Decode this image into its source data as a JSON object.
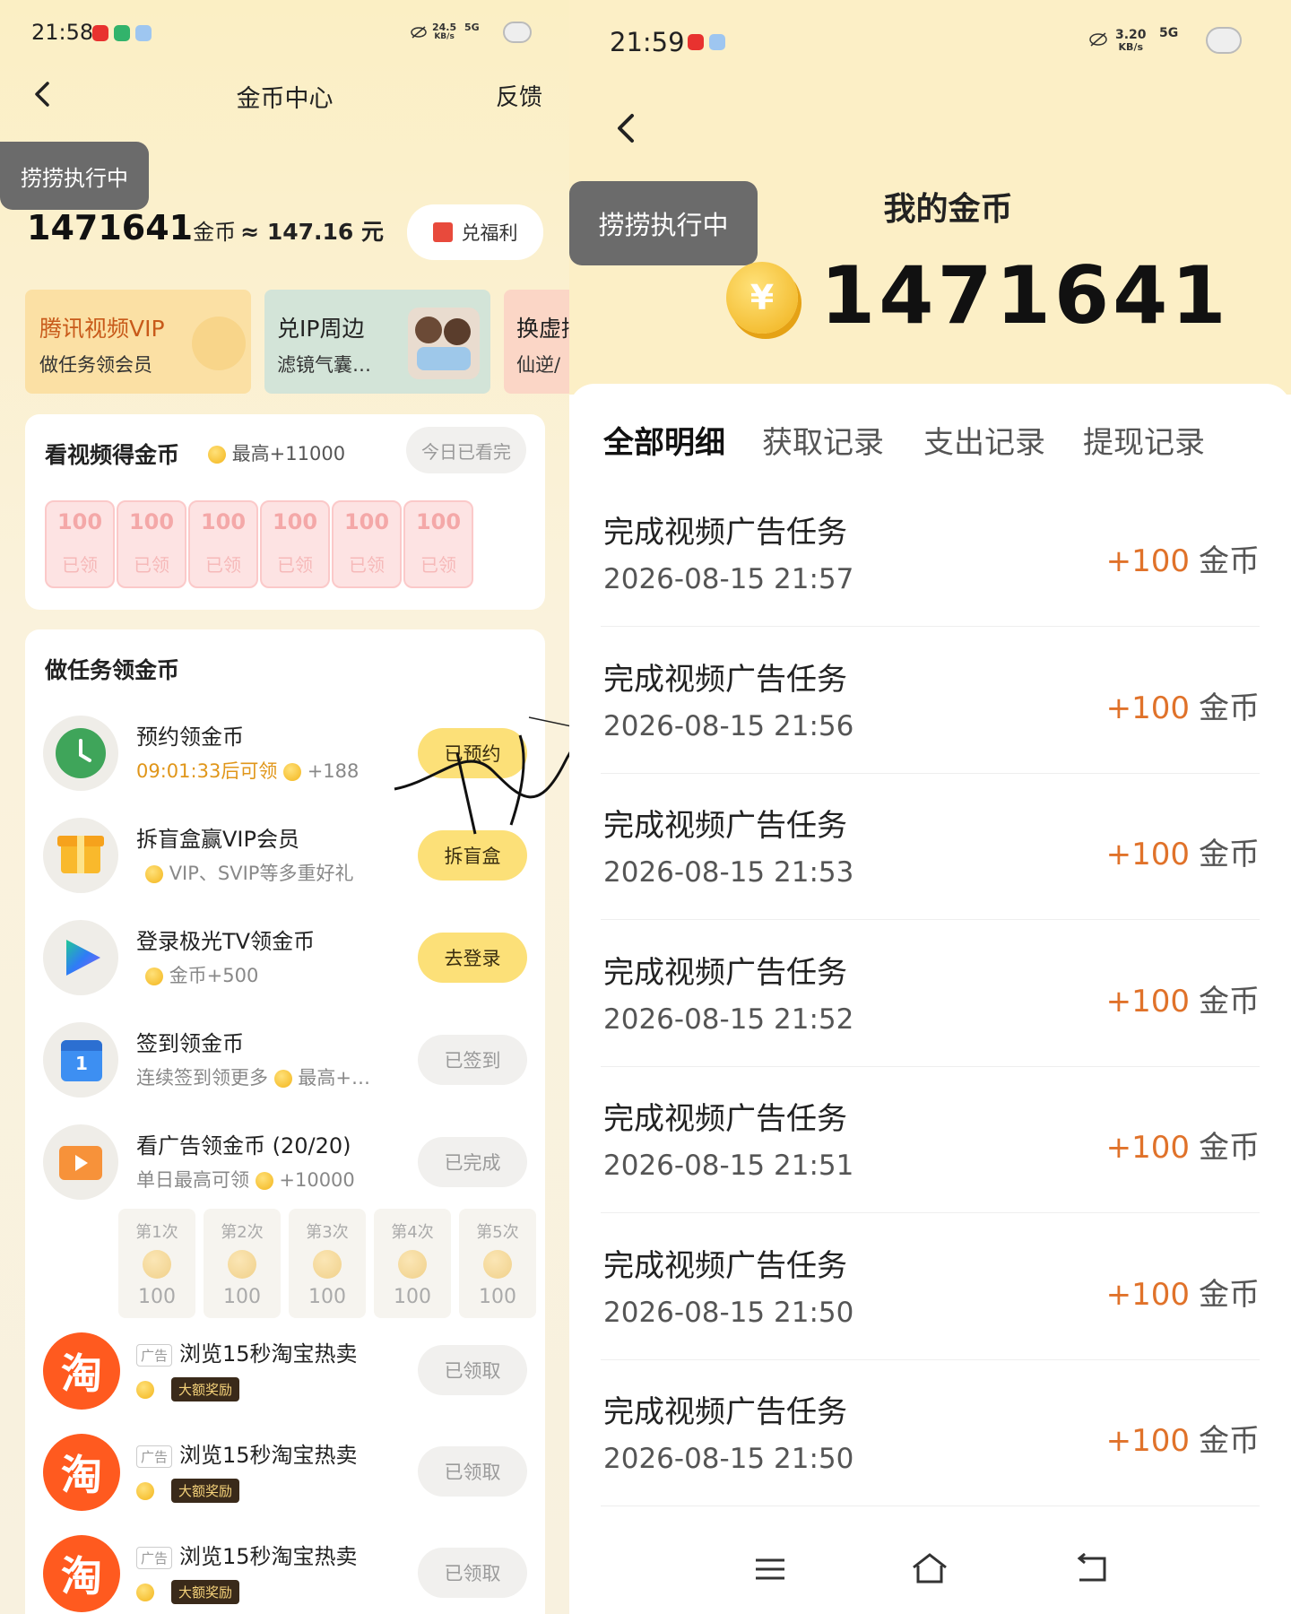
{
  "left": {
    "status": {
      "time": "21:58",
      "net_speed": "24.5",
      "net_unit": "KB/s",
      "signal": "5G"
    },
    "header": {
      "title": "金币中心",
      "feedback": "反馈"
    },
    "toast": "捞捞执行中",
    "balance": {
      "coins": "1471641",
      "unit": "金币",
      "approx": "≈ 147.16 元"
    },
    "redeem_button": "兑福利",
    "banners": [
      {
        "title": "腾讯视频VIP",
        "sub": "做任务领会员"
      },
      {
        "title": "兑IP周边",
        "sub": "滤镜气囊…"
      },
      {
        "title": "换虚拟",
        "sub": "仙逆/"
      }
    ],
    "video_card": {
      "title": "看视频得金币",
      "max": "最高+11000",
      "status_button": "今日已看完",
      "bags": [
        {
          "value": "100",
          "state": "已领"
        },
        {
          "value": "100",
          "state": "已领"
        },
        {
          "value": "100",
          "state": "已领"
        },
        {
          "value": "100",
          "state": "已领"
        },
        {
          "value": "100",
          "state": "已领"
        },
        {
          "value": "100",
          "state": "已领"
        }
      ]
    },
    "tasks_card": {
      "title": "做任务领金币",
      "tasks": [
        {
          "icon": "clock-icon",
          "title": "预约领金币",
          "sub": "09:01:33后可领",
          "reward": "+188",
          "button": "已预约",
          "button_style": "yellow"
        },
        {
          "icon": "gift-icon",
          "title": "拆盲盒赢VIP会员",
          "sub": "VIP、SVIP等多重好礼",
          "reward": "",
          "button": "拆盲盒",
          "button_style": "yellow"
        },
        {
          "icon": "play-logo-icon",
          "title": "登录极光TV领金币",
          "sub": "金币+500",
          "reward": "",
          "button": "去登录",
          "button_style": "yellow"
        },
        {
          "icon": "calendar-icon",
          "title": "签到领金币",
          "sub": "连续签到领更多",
          "reward": "最高+…",
          "button": "已签到",
          "button_style": "gray"
        },
        {
          "icon": "video-ad-icon",
          "title": "看广告领金币 (20/20)",
          "sub": "单日最高可领",
          "reward": "+10000",
          "button": "已完成",
          "button_style": "gray"
        }
      ],
      "slots": [
        {
          "label": "第1次",
          "value": "100"
        },
        {
          "label": "第2次",
          "value": "100"
        },
        {
          "label": "第3次",
          "value": "100"
        },
        {
          "label": "第4次",
          "value": "100"
        },
        {
          "label": "第5次",
          "value": "100"
        }
      ],
      "ads": [
        {
          "tag": "广告",
          "title": "浏览15秒淘宝热卖",
          "badge": "大额奖励",
          "button": "已领取",
          "logo": "淘"
        },
        {
          "tag": "广告",
          "title": "浏览15秒淘宝热卖",
          "badge": "大额奖励",
          "button": "已领取",
          "logo": "淘"
        },
        {
          "tag": "广告",
          "title": "浏览15秒淘宝热卖",
          "badge": "大额奖励",
          "button": "已领取",
          "logo": "淘"
        }
      ]
    }
  },
  "right": {
    "status": {
      "time": "21:59",
      "net_speed": "3.20",
      "net_unit": "KB/s",
      "signal": "5G"
    },
    "toast": "捞捞执行中",
    "title": "我的金币",
    "balance": "1471641",
    "coin_symbol": "¥",
    "tabs": [
      "全部明细",
      "获取记录",
      "支出记录",
      "提现记录"
    ],
    "records": [
      {
        "title": "完成视频广告任务",
        "date": "2026-08-15 21:57",
        "amount": "+100",
        "unit": "金币"
      },
      {
        "title": "完成视频广告任务",
        "date": "2026-08-15 21:56",
        "amount": "+100",
        "unit": "金币"
      },
      {
        "title": "完成视频广告任务",
        "date": "2026-08-15 21:53",
        "amount": "+100",
        "unit": "金币"
      },
      {
        "title": "完成视频广告任务",
        "date": "2026-08-15 21:52",
        "amount": "+100",
        "unit": "金币"
      },
      {
        "title": "完成视频广告任务",
        "date": "2026-08-15 21:51",
        "amount": "+100",
        "unit": "金币"
      },
      {
        "title": "完成视频广告任务",
        "date": "2026-08-15 21:50",
        "amount": "+100",
        "unit": "金币"
      },
      {
        "title": "完成视频广告任务",
        "date": "2026-08-15 21:50",
        "amount": "+100",
        "unit": "金币"
      }
    ]
  },
  "colors": {
    "accent_orange": "#e0722a",
    "brand_yellow": "#fce078",
    "taobao_orange": "#ff5a1f"
  }
}
